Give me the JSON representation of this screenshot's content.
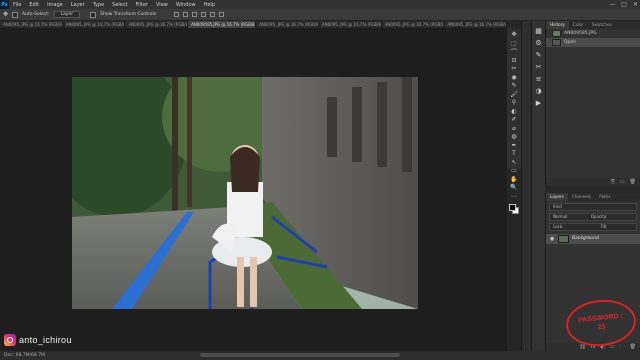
{
  "app": {
    "logo": "Ps"
  },
  "menu": [
    "File",
    "Edit",
    "Image",
    "Layer",
    "Type",
    "Select",
    "Filter",
    "View",
    "Window",
    "Help"
  ],
  "window_controls": {
    "minimize": "—",
    "maximize": "□",
    "close": "✕"
  },
  "options_bar": {
    "auto_select_label": "Auto-Select:",
    "auto_select_value": "Layer",
    "transform_label": "Show Transform Controls"
  },
  "doc_tabs": [
    {
      "label": "AN0095..JPG @ 16.7% (RGB/8)",
      "active": false
    },
    {
      "label": "AN0095..JPG @ 16.7% (RGB/8)",
      "active": false
    },
    {
      "label": "AN0095..JPG @ 16.7% (RGB/8)",
      "active": false
    },
    {
      "label": "AN009595.JPG @ 16.7% (RGB/8*)",
      "active": true
    },
    {
      "label": "AN0095..JPG @ 16.7% (RGB/8)",
      "active": false
    },
    {
      "label": "AN0095..JPG @ 16.7% (RGB/8)",
      "active": false
    },
    {
      "label": "AN0095..JPG @ 16.7% (RGB/8)",
      "active": false
    },
    {
      "label": "AN0095..JPG @ 16.7% (RGB/8)",
      "active": false
    }
  ],
  "tools": [
    "✥",
    "⬚",
    "⌒",
    "⊡",
    "✂",
    "◉",
    "✎",
    "🖌",
    "⚲",
    "◐",
    "✐",
    "⌀",
    "◍",
    "✒",
    "T",
    "↖",
    "▭",
    "✋",
    "🔍",
    "⋯"
  ],
  "right_icons": [
    "▦",
    "⚙",
    "✎",
    "✂",
    "≡",
    "◑",
    "▶"
  ],
  "history_panel": {
    "tabs": [
      "History",
      "Color",
      "Swatches"
    ],
    "rows": [
      {
        "label": "AN009595.JPG",
        "selected": false
      },
      {
        "label": "Open",
        "selected": true
      }
    ],
    "footer": [
      "⎘",
      "▭",
      "🗑"
    ]
  },
  "layers_panel": {
    "tabs": [
      "Layers",
      "Channels",
      "Paths"
    ],
    "kind": "Kind",
    "mode": "Normal",
    "opacity_label": "Opacity:",
    "lock_label": "Lock:",
    "fill_label": "Fill:",
    "layer": {
      "name": "Background"
    },
    "footer": [
      "⛓",
      "fx",
      "◐",
      "▭",
      "🗀",
      "🗑"
    ]
  },
  "status": {
    "text": "Doc: 68.7M/68.7M"
  },
  "watermark": {
    "handle": "anto_ichirou"
  },
  "password_stamp": {
    "line1": "PASSWORD :",
    "line2": "23"
  }
}
